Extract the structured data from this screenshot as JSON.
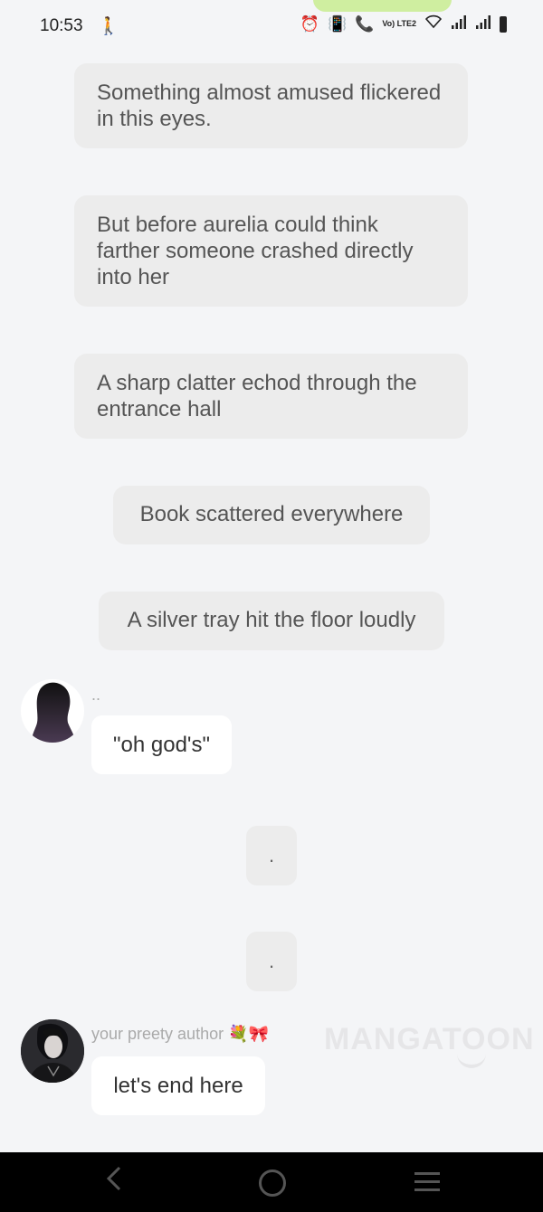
{
  "status_bar": {
    "time": "10:53",
    "walk_icon": "walking-person-icon",
    "volte_label": "Vo) LTE2"
  },
  "narrations": [
    "Something almost amused flickered in this eyes.",
    "But before aurelia could think farther someone crashed directly into her",
    "A sharp clatter echod through the entrance hall",
    "Book scattered everywhere",
    "A silver tray hit the floor loudly"
  ],
  "message1": {
    "speaker": "..",
    "text": "\"oh god's\""
  },
  "dots": [
    ".",
    "."
  ],
  "message2": {
    "speaker": "your preety author 💐🎀",
    "text": "let's end here"
  },
  "watermark": "MANGATOON",
  "colors": {
    "background": "#f4f5f7",
    "narration_bg": "#ececec",
    "bubble_bg": "#ffffff",
    "status_pill": "#cfeea0",
    "nav_bar": "#000000"
  }
}
